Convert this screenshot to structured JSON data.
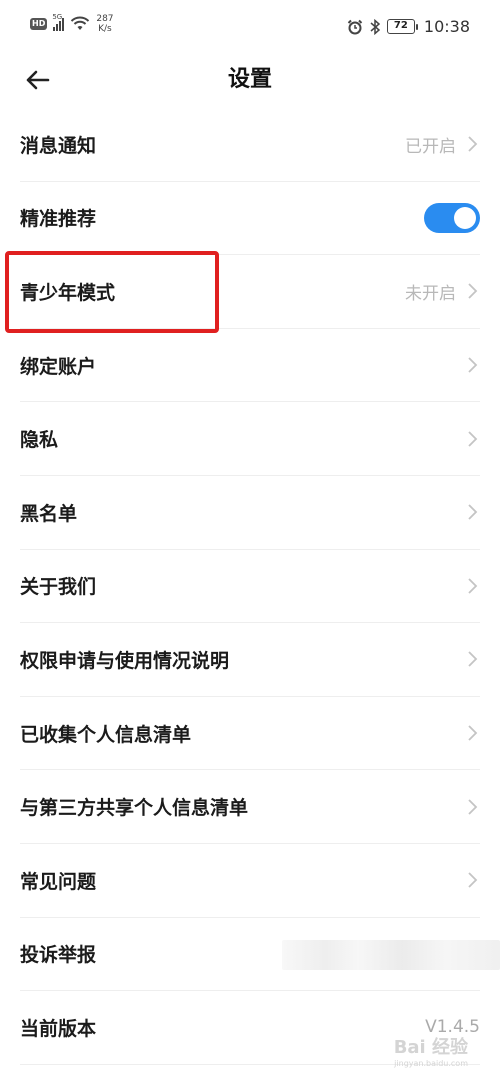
{
  "status_bar": {
    "hd": "HD",
    "net": "5G",
    "speed_value": "287",
    "speed_unit": "K/s",
    "battery": "72",
    "time": "10:38"
  },
  "header": {
    "title": "设置"
  },
  "rows": [
    {
      "label": "消息通知",
      "value": "已开启"
    },
    {
      "label": "精准推荐",
      "toggle_on": true
    },
    {
      "label": "青少年模式",
      "value": "未开启"
    },
    {
      "label": "绑定账户"
    },
    {
      "label": "隐私"
    },
    {
      "label": "黑名单"
    },
    {
      "label": "关于我们"
    },
    {
      "label": "权限申请与使用情况说明"
    },
    {
      "label": "已收集个人信息清单"
    },
    {
      "label": "与第三方共享个人信息清单"
    },
    {
      "label": "常见问题"
    },
    {
      "label": "投诉举报"
    },
    {
      "label": "当前版本",
      "value": "V1.4.5"
    }
  ],
  "colors": {
    "toggle_accent": "#2a8cf0",
    "highlight": "#e02020"
  },
  "watermark": {
    "text": "Bai 经验",
    "url": "jingyan.baidu.com"
  }
}
